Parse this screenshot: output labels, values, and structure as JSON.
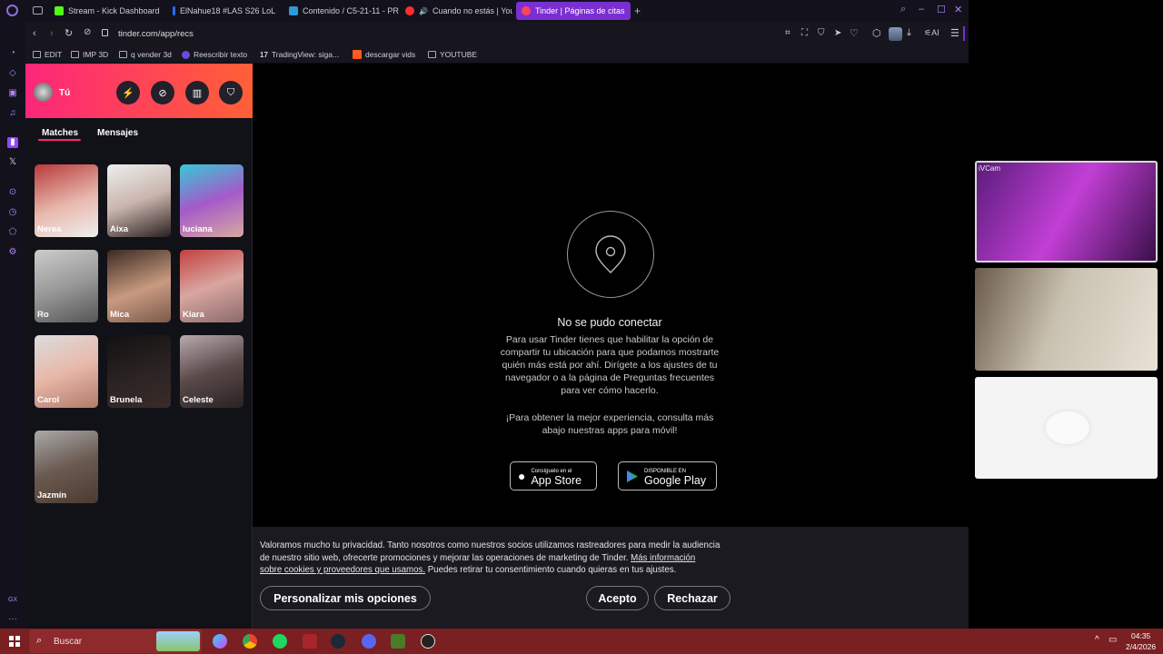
{
  "browser": {
    "tabs": [
      {
        "label": "Stream - Kick Dashboard",
        "color": "#53fc18"
      },
      {
        "label": "ElNahue18 #LAS S26 LoL",
        "color": "#2a6bff"
      },
      {
        "label": "Contenido / C5-21-11 - PR",
        "color": "#2e9bd6"
      },
      {
        "label": "Cuando no estás | You",
        "color": "#ff2d2d"
      },
      {
        "label": "Tinder | Páginas de citas",
        "color": "#ff4458"
      }
    ],
    "url": "tinder.com/app/recs",
    "ai_label": "AI",
    "bookmarks": [
      "EDIT",
      "IMP 3D",
      "q vender 3d",
      "Reescribir texto",
      "TradingView: siga...",
      "descargar vids",
      "YOUTUBE"
    ]
  },
  "profile": {
    "name": "Tú"
  },
  "tabs": {
    "matches": "Matches",
    "messages": "Mensajes"
  },
  "matches": [
    "Nerea",
    "Aixa",
    "luciana",
    "Ro",
    "Mica",
    "Kiara",
    "Carol",
    "Brunela",
    "Celeste",
    "Jazmín"
  ],
  "error": {
    "title": "No se pudo conectar",
    "body": [
      "Para usar Tinder tienes que habilitar la opción de",
      "compartir tu ubicación para que podamos mostrarte",
      "quién más está por ahí. Dirígete a los ajustes de tu",
      "navegador o a la página de Preguntas frecuentes",
      "para ver cómo hacerlo."
    ],
    "promo": [
      "¡Para obtener la mejor experiencia, consulta más",
      "abajo nuestras apps para móvil!"
    ]
  },
  "stores": {
    "apple_small": "Consíguelo en el",
    "apple_big": "App Store",
    "google_small": "DISPONIBLE EN",
    "google_big": "Google Play"
  },
  "cookie": {
    "line1": "Valoramos mucho tu privacidad. Tanto nosotros como nuestros socios utilizamos rastreadores para medir la audiencia",
    "line2a": "de nuestro sitio web, ofrecerte promociones y mejorar las operaciones de marketing de Tinder.",
    "link1": "Más información",
    "link2": "sobre cookies y proveedores que usamos.",
    "line3b": "Puedes retirar tu consentimiento cuando quieras en tus ajustes.",
    "customize": "Personalizar mis opciones",
    "accept": "Acepto",
    "reject": "Rechazar"
  },
  "overlay": {
    "cam_label": "iVCam"
  },
  "taskbar": {
    "search": "Buscar",
    "time": "04:35",
    "date": "2/4/2026"
  },
  "colors": {
    "tinder_gradient_start": "#fd267a",
    "tinder_gradient_end": "#ff6036",
    "active_tab": "#7a2fd0",
    "taskbar": "#7a1f22"
  }
}
